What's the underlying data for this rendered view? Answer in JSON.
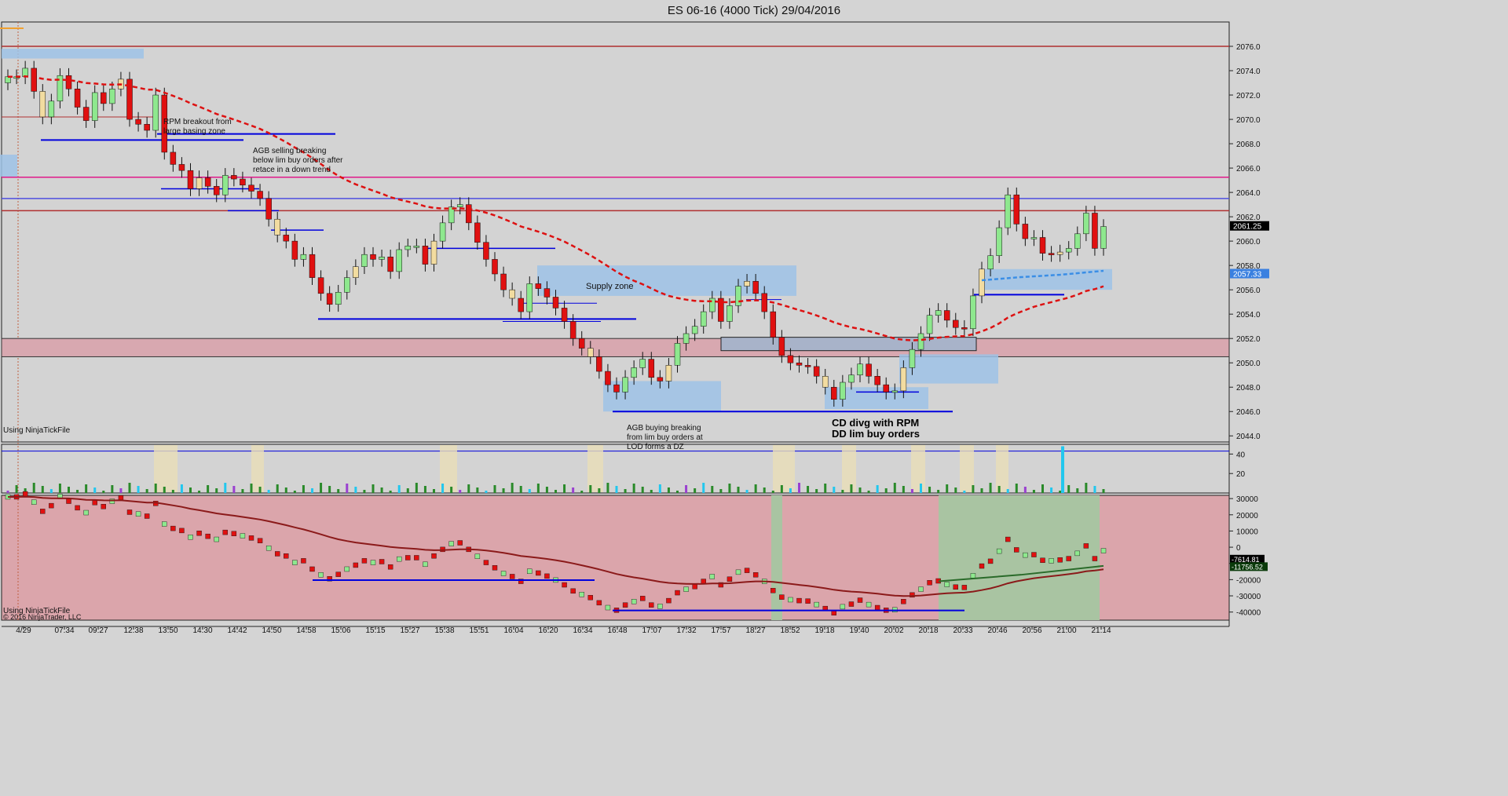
{
  "window": {
    "title": "ES 06-16 (4000 Tick)  29/04/2016"
  },
  "watermark": {
    "top": "Using NinjaTickFile",
    "bottom": "Using NinjaTickFile",
    "copyright": "© 2016 NinjaTrader, LLC"
  },
  "price_badges": {
    "last": "2061.25",
    "avg": "2057.33"
  },
  "delta_badges": {
    "a": "-7614.81",
    "b": "-11756.52"
  },
  "annotations": {
    "rpm": [
      "RPM breakout from",
      "large basing zone"
    ],
    "agb_sell": [
      "AGB selling breaking",
      "below lim buy orders after",
      "retace in a down trend"
    ],
    "supply": "Supply zone",
    "agb_buy": [
      "AGB buying breaking",
      "from lim buy orders at",
      "LOD forms a DZ"
    ],
    "cd_divg": [
      "CD divg with RPM",
      "DD lim buy orders"
    ]
  },
  "colors": {
    "up": "#8ee88e",
    "down": "#e01010",
    "pale": "#f2dca0",
    "ma": "#dd1111",
    "level": "#b03030",
    "magenta": "#e0198a",
    "blue": "#0000dd",
    "zone_blue": "#9ec2e6",
    "zone_red": "#d8a8b0"
  },
  "chart_data": [
    {
      "type": "candlestick",
      "title": "ES 06-16 (4000 Tick)  29/04/2016",
      "x_tick_labels": [
        "4/29",
        "07:34",
        "09:27",
        "12:38",
        "13:50",
        "14:30",
        "14:42",
        "14:50",
        "14:58",
        "15:06",
        "15:15",
        "15:27",
        "15:38",
        "15:51",
        "16:04",
        "16:20",
        "16:34",
        "16:48",
        "17:07",
        "17:32",
        "17:57",
        "18:27",
        "18:52",
        "19:18",
        "19:40",
        "20:02",
        "20:18",
        "20:33",
        "20:46",
        "20:56",
        "21:00",
        "21:14"
      ],
      "y_ticks": [
        2044.0,
        2046.0,
        2048.0,
        2050.0,
        2052.0,
        2054.0,
        2056.0,
        2058.0,
        2060.0,
        2062.0,
        2064.0,
        2066.0,
        2068.0,
        2070.0,
        2072.0,
        2074.0,
        2076.0
      ],
      "ylim": [
        2043.5,
        2078.0
      ],
      "last_price": 2061.25,
      "ma_value": 2057.33,
      "horizontal_levels": [
        2076.0,
        2062.5,
        2065.25,
        2063.5,
        2068.5
      ],
      "zones": [
        {
          "label": "Supply zone",
          "from": 2055.5,
          "to": 2058.0
        },
        {
          "label": "",
          "from": 2050.5,
          "to": 2052.0
        }
      ],
      "close": [
        2073.5,
        2073.5,
        2074.2,
        2072.3,
        2070.2,
        2071.5,
        2073.6,
        2072.5,
        2071.0,
        2069.9,
        2072.2,
        2071.3,
        2072.5,
        2073.3,
        2070.0,
        2069.6,
        2069.1,
        2072.0,
        2067.3,
        2066.3,
        2065.8,
        2064.3,
        2065.2,
        2064.5,
        2063.8,
        2065.4,
        2065.1,
        2064.6,
        2064.1,
        2063.5,
        2061.8,
        2060.5,
        2060.0,
        2058.5,
        2058.9,
        2057.0,
        2055.7,
        2054.8,
        2055.8,
        2057.0,
        2057.9,
        2058.9,
        2058.5,
        2058.7,
        2057.5,
        2059.3,
        2059.6,
        2059.6,
        2058.1,
        2060.0,
        2061.5,
        2062.8,
        2063.0,
        2061.5,
        2059.9,
        2058.5,
        2057.3,
        2056.0,
        2055.3,
        2054.2,
        2056.5,
        2056.1,
        2055.4,
        2054.5,
        2053.4,
        2052.0,
        2051.2,
        2050.5,
        2049.3,
        2048.2,
        2047.6,
        2048.8,
        2049.6,
        2050.3,
        2048.8,
        2048.5,
        2049.8,
        2051.6,
        2052.4,
        2053.0,
        2054.2,
        2055.3,
        2053.4,
        2054.7,
        2056.3,
        2056.7,
        2055.7,
        2054.2,
        2052.1,
        2050.6,
        2050.0,
        2049.8,
        2049.7,
        2048.9,
        2048.0,
        2047.0,
        2048.4,
        2049.0,
        2049.9,
        2048.9,
        2048.2,
        2047.6,
        2047.7,
        2049.6,
        2051.1,
        2052.4,
        2053.9,
        2054.3,
        2053.5,
        2052.9,
        2052.8,
        2055.5,
        2057.7,
        2058.8,
        2061.1,
        2063.8,
        2061.4,
        2060.2,
        2060.3,
        2059.0,
        2058.9,
        2059.1,
        2059.4,
        2060.6,
        2062.3,
        2059.4,
        2061.2
      ],
      "cum_delta": {
        "y_ticks": [
          -40000,
          -30000,
          -20000,
          -10000,
          0,
          10000,
          20000,
          30000
        ],
        "ylim": [
          -45000,
          32000
        ],
        "last_values": [
          -7614.81,
          -11756.52
        ],
        "levels": [
          -20000,
          -39000
        ]
      },
      "volume_histogram": {
        "y_ticks": [
          20,
          40
        ]
      }
    }
  ]
}
